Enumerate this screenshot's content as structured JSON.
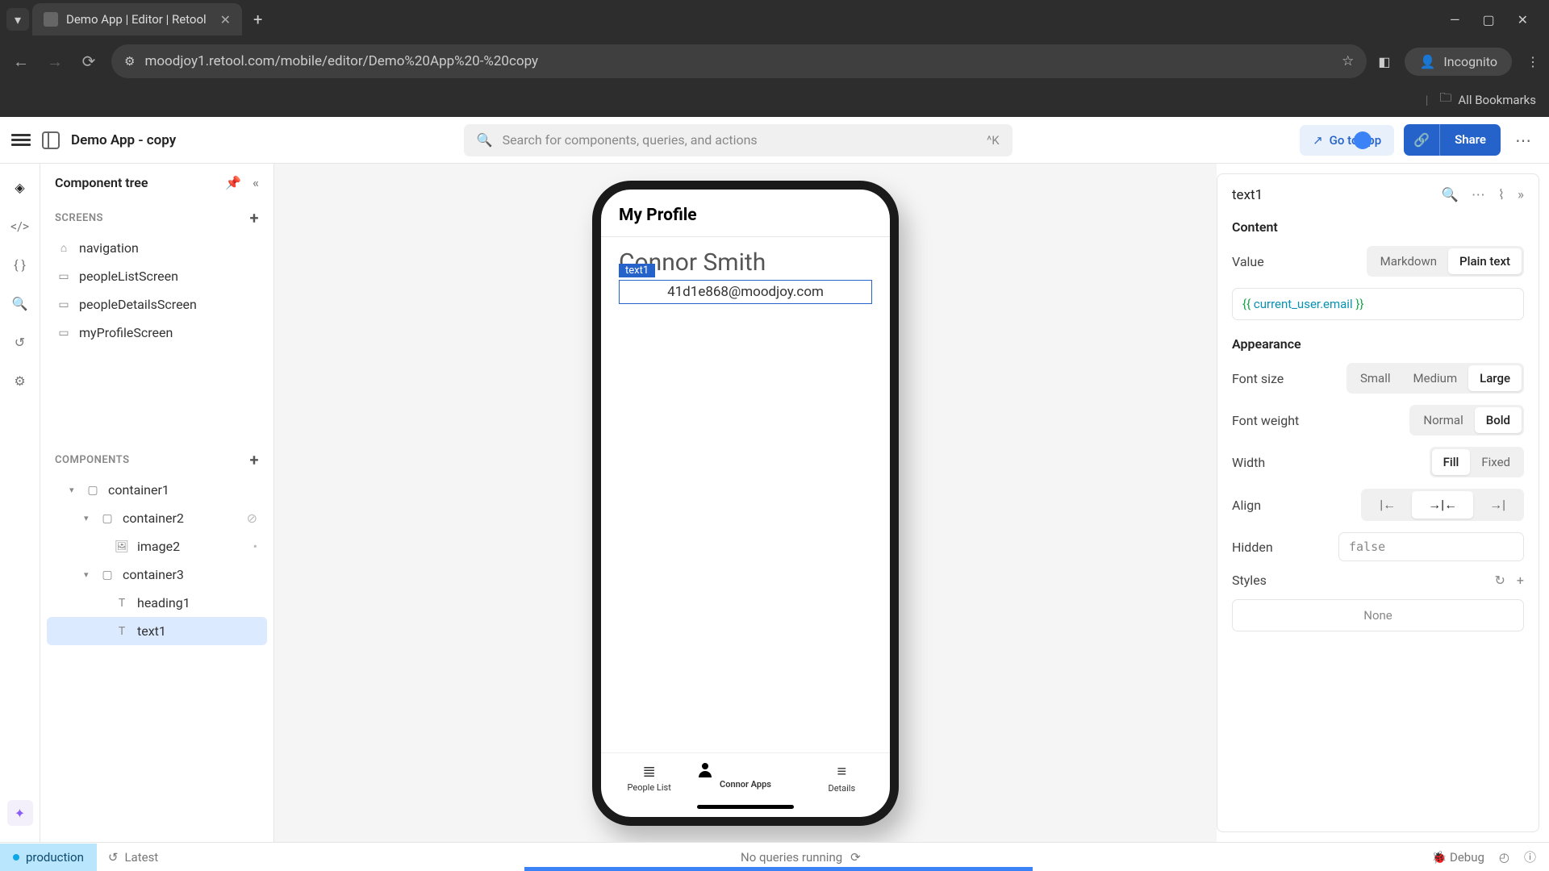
{
  "browser": {
    "tab_title": "Demo App | Editor | Retool",
    "url": "moodjoy1.retool.com/mobile/editor/Demo%20App%20-%20copy",
    "incognito": "Incognito",
    "bookmarks": "All Bookmarks"
  },
  "topbar": {
    "app_name": "Demo App - copy",
    "search_placeholder": "Search for components, queries, and actions",
    "search_kbd": "^K",
    "goto": "Go to app",
    "share": "Share"
  },
  "left_panel": {
    "title": "Component tree",
    "screens_label": "SCREENS",
    "components_label": "COMPONENTS",
    "screens": [
      {
        "name": "navigation",
        "icon": "home"
      },
      {
        "name": "peopleListScreen",
        "icon": "screen"
      },
      {
        "name": "peopleDetailsScreen",
        "icon": "screen"
      },
      {
        "name": "myProfileScreen",
        "icon": "screen"
      }
    ],
    "components": [
      {
        "name": "container1",
        "indent": 0,
        "chev": "▾",
        "icon": "box"
      },
      {
        "name": "container2",
        "indent": 1,
        "chev": "▾",
        "icon": "box",
        "hide": true
      },
      {
        "name": "image2",
        "indent": 2,
        "chev": "",
        "icon": "img",
        "dot": true
      },
      {
        "name": "container3",
        "indent": 1,
        "chev": "▾",
        "icon": "box"
      },
      {
        "name": "heading1",
        "indent": 2,
        "chev": "",
        "icon": "T"
      },
      {
        "name": "text1",
        "indent": 2,
        "chev": "",
        "icon": "T",
        "selected": true
      }
    ]
  },
  "phone": {
    "header": "My Profile",
    "name": "Connor Smith",
    "selected_tag": "text1",
    "email": "41d1e868@moodjoy.com",
    "nav": [
      {
        "label": "People List",
        "icon": "≣"
      },
      {
        "label": "Connor Apps",
        "icon": "person",
        "active": true
      },
      {
        "label": "Details",
        "icon": "≡"
      }
    ]
  },
  "inspector": {
    "title": "text1",
    "content_label": "Content",
    "value_label": "Value",
    "value_seg": [
      "Markdown",
      "Plain text"
    ],
    "value_active": 1,
    "code_prefix": "{{ ",
    "code_expr": "current_user.email",
    "code_suffix": " }}",
    "appearance_label": "Appearance",
    "fontsize_label": "Font size",
    "fontsize_opts": [
      "Small",
      "Medium",
      "Large"
    ],
    "fontsize_active": 2,
    "fontweight_label": "Font weight",
    "fontweight_opts": [
      "Normal",
      "Bold"
    ],
    "fontweight_active": 1,
    "width_label": "Width",
    "width_opts": [
      "Fill",
      "Fixed"
    ],
    "width_active": 0,
    "align_label": "Align",
    "hidden_label": "Hidden",
    "hidden_value": "false",
    "styles_label": "Styles",
    "styles_none": "None"
  },
  "status": {
    "env": "production",
    "latest": "Latest",
    "center": "No queries running",
    "debug": "Debug"
  }
}
